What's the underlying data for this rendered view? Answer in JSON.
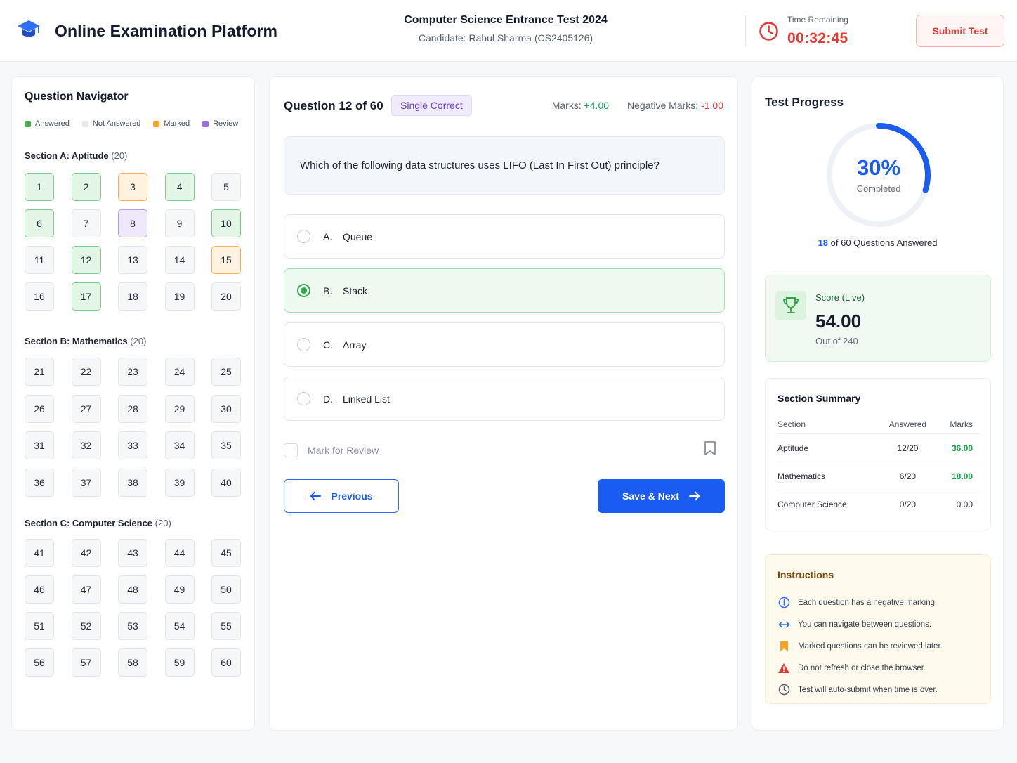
{
  "header": {
    "app_title": "Online Examination Platform",
    "test_title": "Computer Science Entrance Test 2024",
    "candidate": "Candidate: Rahul Sharma (CS2405126)",
    "timer_label": "Time Remaining",
    "timer_value": "00:32:45",
    "submit_label": "Submit Test",
    "icons": {
      "brand": "graduation-cap-icon",
      "timer": "clock-icon"
    }
  },
  "navigator": {
    "title": "Question Navigator",
    "legend": [
      {
        "label": "Answered",
        "color": "#4caf50"
      },
      {
        "label": "Not Answered",
        "color": "#e6e8ec"
      },
      {
        "label": "Marked",
        "color": "#f5a623"
      },
      {
        "label": "Review",
        "color": "#9c6ee8"
      }
    ],
    "sections": [
      {
        "name": "Section A: Aptitude",
        "count": "(20)",
        "questions": [
          {
            "n": "1",
            "state": "answered"
          },
          {
            "n": "2",
            "state": "answered"
          },
          {
            "n": "3",
            "state": "marked"
          },
          {
            "n": "4",
            "state": "answered"
          },
          {
            "n": "5",
            "state": "not-answered"
          },
          {
            "n": "6",
            "state": "answered"
          },
          {
            "n": "7",
            "state": "not-answered"
          },
          {
            "n": "8",
            "state": "review"
          },
          {
            "n": "9",
            "state": "not-answered"
          },
          {
            "n": "10",
            "state": "answered"
          },
          {
            "n": "11",
            "state": "not-answered"
          },
          {
            "n": "12",
            "state": "answered"
          },
          {
            "n": "13",
            "state": "not-answered"
          },
          {
            "n": "14",
            "state": "not-answered"
          },
          {
            "n": "15",
            "state": "marked"
          },
          {
            "n": "16",
            "state": "not-answered"
          },
          {
            "n": "17",
            "state": "answered"
          },
          {
            "n": "18",
            "state": "not-answered"
          },
          {
            "n": "19",
            "state": "not-answered"
          },
          {
            "n": "20",
            "state": "not-answered"
          }
        ]
      },
      {
        "name": "Section B: Mathematics",
        "count": "(20)",
        "questions": [
          {
            "n": "21",
            "state": "not-answered"
          },
          {
            "n": "22",
            "state": "not-answered"
          },
          {
            "n": "23",
            "state": "not-answered"
          },
          {
            "n": "24",
            "state": "not-answered"
          },
          {
            "n": "25",
            "state": "not-answered"
          },
          {
            "n": "26",
            "state": "not-answered"
          },
          {
            "n": "27",
            "state": "not-answered"
          },
          {
            "n": "28",
            "state": "not-answered"
          },
          {
            "n": "29",
            "state": "not-answered"
          },
          {
            "n": "30",
            "state": "not-answered"
          },
          {
            "n": "31",
            "state": "not-answered"
          },
          {
            "n": "32",
            "state": "not-answered"
          },
          {
            "n": "33",
            "state": "not-answered"
          },
          {
            "n": "34",
            "state": "not-answered"
          },
          {
            "n": "35",
            "state": "not-answered"
          },
          {
            "n": "36",
            "state": "not-answered"
          },
          {
            "n": "37",
            "state": "not-answered"
          },
          {
            "n": "38",
            "state": "not-answered"
          },
          {
            "n": "39",
            "state": "not-answered"
          },
          {
            "n": "40",
            "state": "not-answered"
          }
        ]
      },
      {
        "name": "Section C: Computer Science",
        "count": "(20)",
        "questions": [
          {
            "n": "41",
            "state": "not-answered"
          },
          {
            "n": "42",
            "state": "not-answered"
          },
          {
            "n": "43",
            "state": "not-answered"
          },
          {
            "n": "44",
            "state": "not-answered"
          },
          {
            "n": "45",
            "state": "not-answered"
          },
          {
            "n": "46",
            "state": "not-answered"
          },
          {
            "n": "47",
            "state": "not-answered"
          },
          {
            "n": "48",
            "state": "not-answered"
          },
          {
            "n": "49",
            "state": "not-answered"
          },
          {
            "n": "50",
            "state": "not-answered"
          },
          {
            "n": "51",
            "state": "not-answered"
          },
          {
            "n": "52",
            "state": "not-answered"
          },
          {
            "n": "53",
            "state": "not-answered"
          },
          {
            "n": "54",
            "state": "not-answered"
          },
          {
            "n": "55",
            "state": "not-answered"
          },
          {
            "n": "56",
            "state": "not-answered"
          },
          {
            "n": "57",
            "state": "not-answered"
          },
          {
            "n": "58",
            "state": "not-answered"
          },
          {
            "n": "59",
            "state": "not-answered"
          },
          {
            "n": "60",
            "state": "not-answered"
          }
        ]
      }
    ]
  },
  "question": {
    "heading": "Question 12 of 60",
    "type": "Single Correct",
    "marks_label": "Marks:",
    "marks_value": "+4.00",
    "negative_label": "Negative Marks:",
    "negative_value": "-1.00",
    "text": "Which of the following data structures uses LIFO (Last In First Out) principle?",
    "options": [
      {
        "letter": "A.",
        "text": "Queue",
        "selected": false
      },
      {
        "letter": "B.",
        "text": "Stack",
        "selected": true
      },
      {
        "letter": "C.",
        "text": "Array",
        "selected": false
      },
      {
        "letter": "D.",
        "text": "Linked List",
        "selected": false
      }
    ],
    "mark_review_label": "Mark for Review",
    "previous_label": "Previous",
    "next_label": "Save & Next"
  },
  "progress": {
    "title": "Test Progress",
    "percent_label": "30%",
    "percent_value": 0.3,
    "completed_label": "Completed",
    "answered_count": "18",
    "answered_suffix": " of 60 Questions Answered",
    "accent_color": "#1a5cf2"
  },
  "score": {
    "label": "Score (Live)",
    "value": "54.00",
    "out_of": "Out of 240",
    "icon": "trophy-icon"
  },
  "summary": {
    "title": "Section Summary",
    "headers": [
      "Section",
      "Answered",
      "Marks"
    ],
    "rows": [
      {
        "section": "Aptitude",
        "answered": "12/20",
        "marks": "36.00",
        "highlight": true
      },
      {
        "section": "Mathematics",
        "answered": "6/20",
        "marks": "18.00",
        "highlight": true
      },
      {
        "section": "Computer Science",
        "answered": "0/20",
        "marks": "0.00",
        "highlight": false
      }
    ]
  },
  "instructions": {
    "title": "Instructions",
    "items": [
      {
        "icon": "info-icon",
        "text": "Each question has a negative marking."
      },
      {
        "icon": "arrows-horizontal-icon",
        "text": "You can navigate between questions."
      },
      {
        "icon": "bookmark-icon",
        "text": "Marked questions can be reviewed later."
      },
      {
        "icon": "warning-icon",
        "text": "Do not refresh or close the browser."
      },
      {
        "icon": "clock-icon",
        "text": "Test will auto-submit when time is over."
      }
    ]
  }
}
